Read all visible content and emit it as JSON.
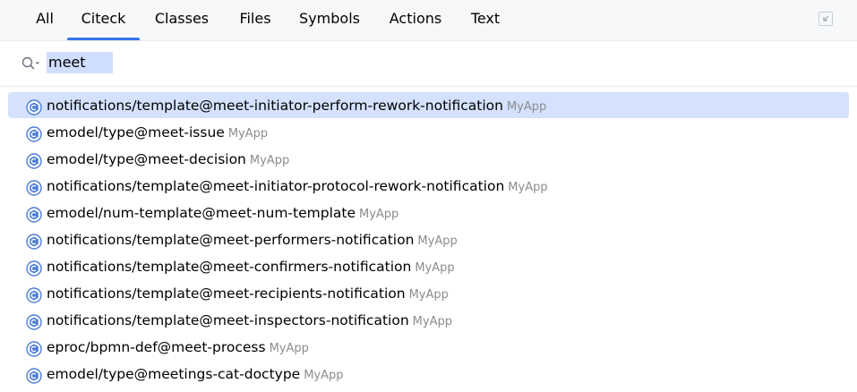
{
  "tabs": [
    {
      "label": "All",
      "active": false
    },
    {
      "label": "Citeck",
      "active": true
    },
    {
      "label": "Classes",
      "active": false
    },
    {
      "label": "Files",
      "active": false
    },
    {
      "label": "Symbols",
      "active": false
    },
    {
      "label": "Actions",
      "active": false
    },
    {
      "label": "Text",
      "active": false
    }
  ],
  "collapse_icon": "collapse-window-icon",
  "search": {
    "icon": "search-with-options-icon",
    "value": "meet"
  },
  "result_icon": "citeck-entity-icon",
  "colors": {
    "accent": "#3574f0",
    "selection": "#d4e2ff",
    "search_highlight": "#d0deff",
    "module_text": "#8c8c8c"
  },
  "results": [
    {
      "name": "notifications/template@meet-initiator-perform-rework-notification",
      "module": "MyApp",
      "selected": true
    },
    {
      "name": "emodel/type@meet-issue",
      "module": "MyApp",
      "selected": false
    },
    {
      "name": "emodel/type@meet-decision",
      "module": "MyApp",
      "selected": false
    },
    {
      "name": "notifications/template@meet-initiator-protocol-rework-notification",
      "module": "MyApp",
      "selected": false
    },
    {
      "name": "emodel/num-template@meet-num-template",
      "module": "MyApp",
      "selected": false
    },
    {
      "name": "notifications/template@meet-performers-notification",
      "module": "MyApp",
      "selected": false
    },
    {
      "name": "notifications/template@meet-confirmers-notification",
      "module": "MyApp",
      "selected": false
    },
    {
      "name": "notifications/template@meet-recipients-notification",
      "module": "MyApp",
      "selected": false
    },
    {
      "name": "notifications/template@meet-inspectors-notification",
      "module": "MyApp",
      "selected": false
    },
    {
      "name": "eproc/bpmn-def@meet-process",
      "module": "MyApp",
      "selected": false
    },
    {
      "name": "emodel/type@meetings-cat-doctype",
      "module": "MyApp",
      "selected": false
    }
  ]
}
